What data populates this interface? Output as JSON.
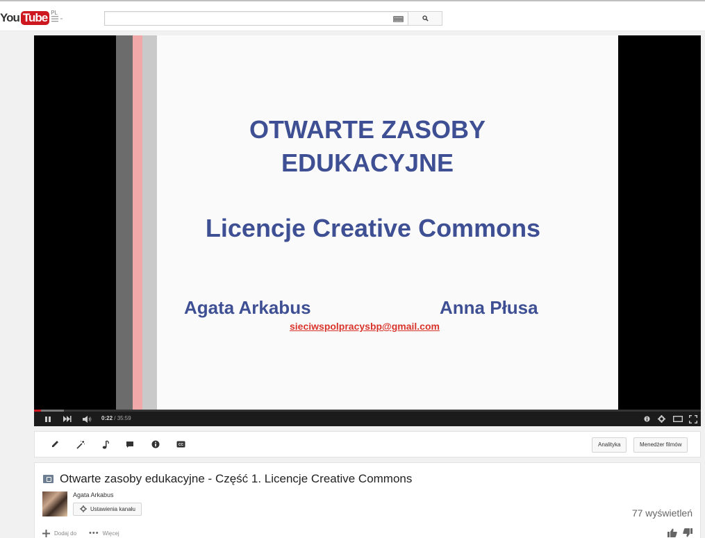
{
  "masthead": {
    "logo_you": "You",
    "logo_tube": "Tube",
    "country_code": "PL",
    "search": {
      "value": "",
      "placeholder": ""
    }
  },
  "player": {
    "slide": {
      "title_line1": "OTWARTE ZASOBY",
      "title_line2": "EDUKACYJNE",
      "subtitle": "Licencje Creative Commons",
      "author_left": "Agata Arkabus",
      "author_right": "Anna Płusa",
      "email": "sieciwspolpracysbp@gmail.com"
    },
    "current_time": "0:22",
    "separator": " / ",
    "duration": "35:59",
    "progress_fraction": 0.0102,
    "buffer_fraction": 0.045
  },
  "creator_bar": {
    "tools": [
      "edit-icon",
      "enhancements-icon",
      "audio-icon",
      "annotations-icon",
      "info-icon",
      "captions-icon"
    ],
    "analytics_label": "Analityka",
    "video_manager_label": "Menedżer filmów"
  },
  "info": {
    "title": "Otwarte zasoby edukacyjne - Część 1. Licencje Creative Commons",
    "channel_name": "Agata Arkabus",
    "channel_settings_label": "Ustawienia kanału",
    "view_count": "77 wyświetleń",
    "add_to_label": "Dodaj do",
    "more_label": "Więcej"
  },
  "colors": {
    "brand_red": "#cc181e",
    "slide_text": "#3e4f93",
    "email_red": "#d9342b"
  }
}
